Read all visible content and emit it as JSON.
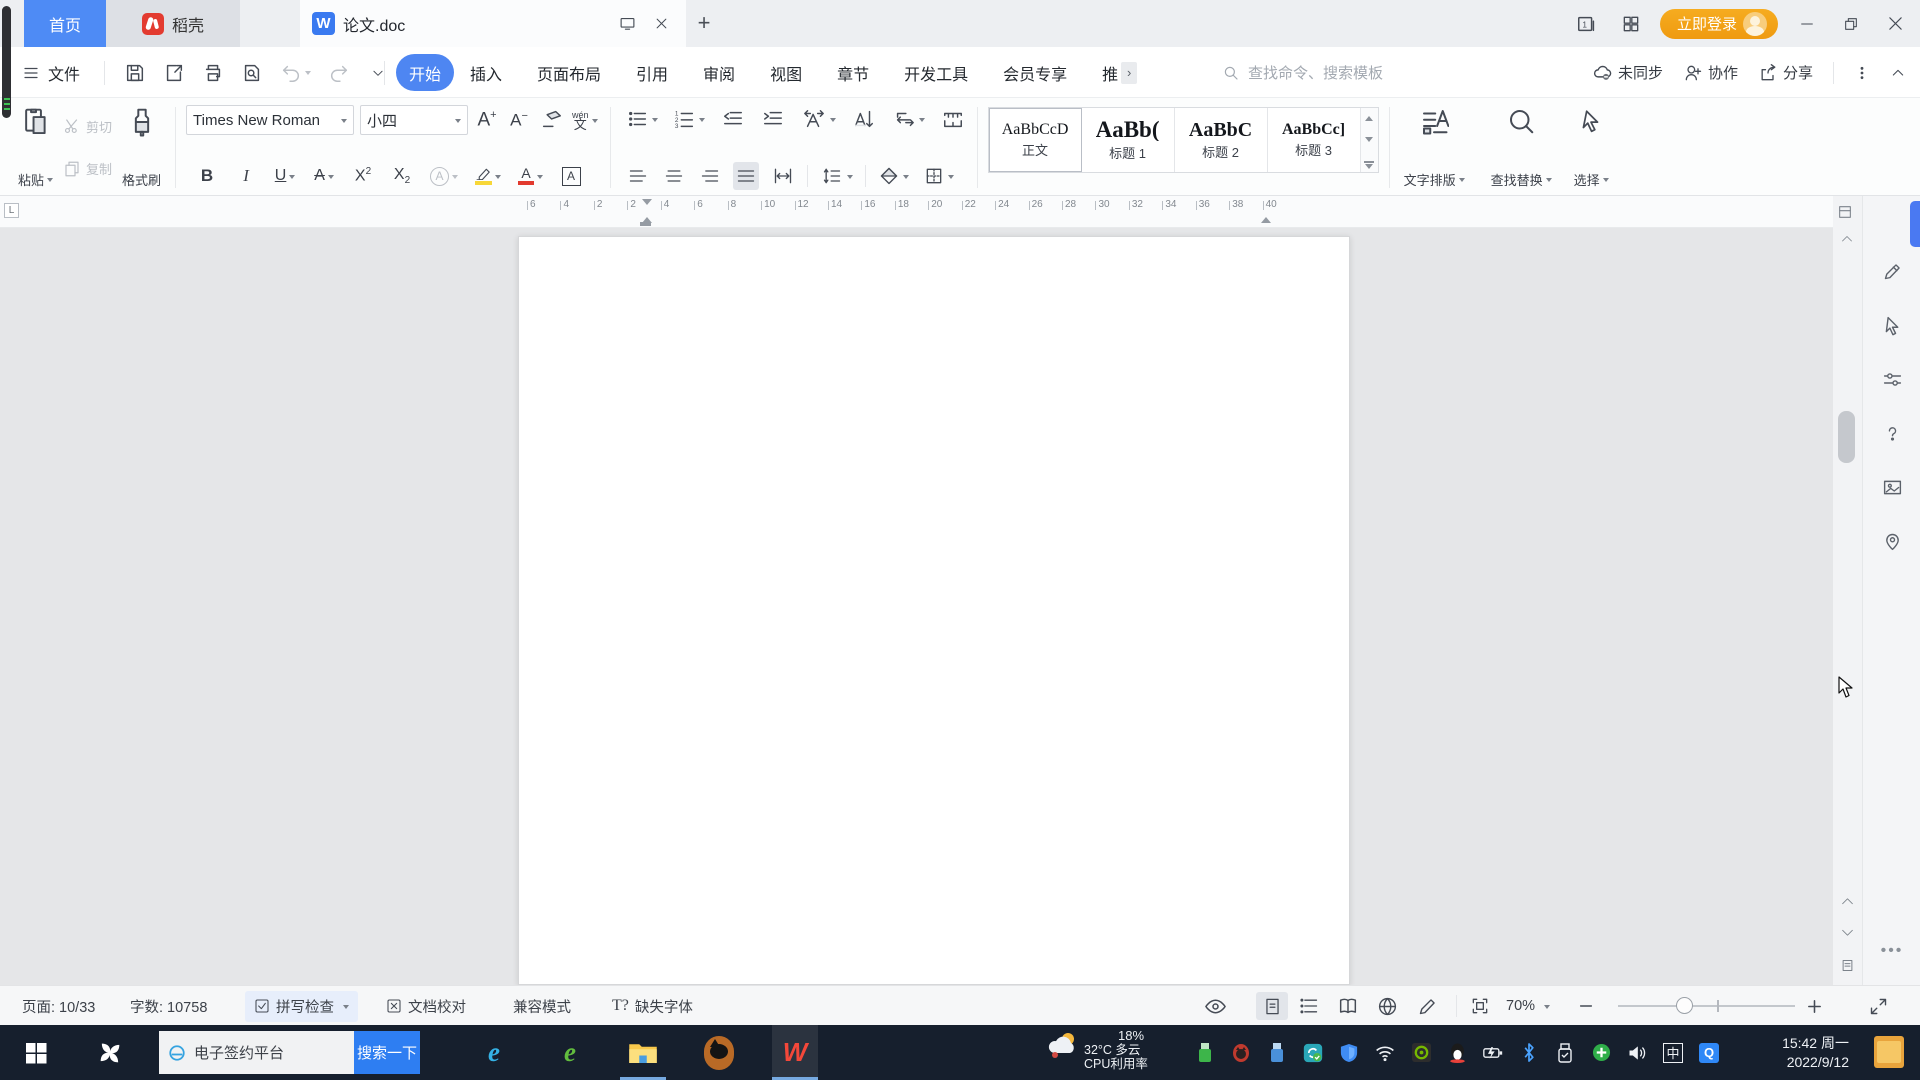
{
  "tabbar": {
    "home": "首页",
    "docer": "稻壳",
    "doc_title": "论文.doc",
    "doc_icon_letter": "W",
    "login": "立即登录"
  },
  "menubar": {
    "file": "文件",
    "active_tab": "开始",
    "items": [
      "插入",
      "页面布局",
      "引用",
      "审阅",
      "视图",
      "章节",
      "开发工具",
      "会员专享"
    ],
    "truncated_item": "推",
    "overflow_arrow": "›",
    "search_placeholder": "查找命令、搜索模板",
    "sync": "未同步",
    "collab": "协作",
    "share": "分享"
  },
  "ribbon": {
    "paste": "粘贴",
    "cut": "剪切",
    "copy": "复制",
    "painter": "格式刷",
    "font_name": "Times New Roman",
    "font_size": "小四",
    "glyphs": {
      "bold": "B",
      "italic": "I",
      "underline": "U",
      "strike": "A",
      "sup_x": "X",
      "sup_n": "2",
      "sub_x": "X",
      "sub_n": "2",
      "ring_a": "A",
      "fontcolor_a": "A",
      "border_a": "A",
      "pinyin_top": "wén",
      "pinyin_bottom": "文",
      "inc_a": "A",
      "inc_sign": "+",
      "dec_a": "A",
      "dec_sign": "−"
    },
    "styles": [
      {
        "preview": "AaBbCcD",
        "label": "正文"
      },
      {
        "preview": "AaBb(",
        "label": "标题 1"
      },
      {
        "preview": "AaBbC",
        "label": "标题 2"
      },
      {
        "preview": "AaBbCc]",
        "label": "标题 3"
      }
    ],
    "text_layout": "文字排版",
    "find_replace": "查找替换",
    "select": "选择"
  },
  "ruler": {
    "ticks": [
      "6",
      "4",
      "2",
      "2",
      "4",
      "6",
      "8",
      "10",
      "12",
      "14",
      "16",
      "18",
      "20",
      "22",
      "24",
      "26",
      "28",
      "30",
      "32",
      "34",
      "36",
      "38",
      "40"
    ]
  },
  "statusbar": {
    "page": "页面: 10/33",
    "words": "字数: 10758",
    "spell_check": "拼写检查",
    "proofread": "文档校对",
    "compat_mode": "兼容模式",
    "missing_font_icon": "T?",
    "missing_font": "缺失字体",
    "zoom": "70%"
  },
  "taskbar": {
    "search_text": "电子签约平台",
    "search_button": "搜索一下",
    "cpu_pct": "18%",
    "weather_temp": "32°C",
    "weather_cond": "多云",
    "cpu_label": "CPU利用率",
    "ime": "中",
    "q_app": "Q",
    "time": "15:42 周一",
    "date": "2022/9/12"
  },
  "colors": {
    "accent_blue": "#4e8bf5",
    "login_orange": "#f3a61c",
    "search_button_blue": "#2e7ef2",
    "font_color_bar": "#e23a2e",
    "highlight_bar": "#f7d738",
    "taskbar_dark": "#161f2d"
  }
}
